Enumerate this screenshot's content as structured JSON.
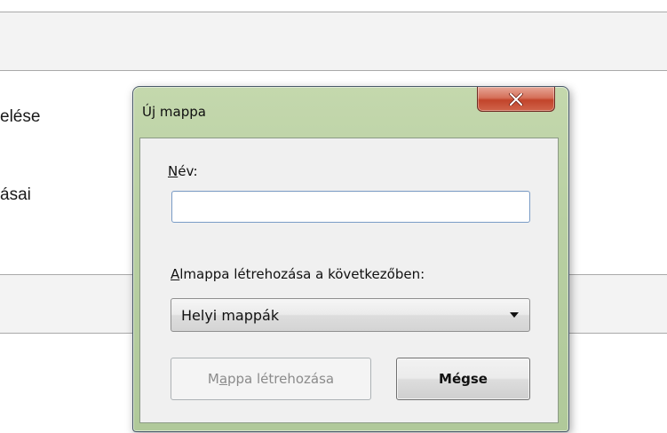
{
  "background": {
    "text_line_1": "elése",
    "text_line_2": "ásai"
  },
  "dialog": {
    "title": "Új mappa",
    "close_icon": "close-x-icon",
    "name_label_mnemonic": "N",
    "name_label_rest": "év:",
    "name_value": "",
    "name_placeholder": "",
    "subfolder_label_mnemonic": "A",
    "subfolder_label_rest": "lmappa létrehozása a következőben:",
    "location_selected": "Helyi mappák",
    "location_dropdown_icon": "chevron-down-icon",
    "create_button_pre": "M",
    "create_button_mnemonic": "a",
    "create_button_post": "ppa létrehozása",
    "create_button_enabled": false,
    "cancel_button": "Mégse"
  },
  "colors": {
    "frame": "#b8cfa2",
    "close_button": "#c2442b",
    "disabled_text": "#8b8b8b"
  }
}
